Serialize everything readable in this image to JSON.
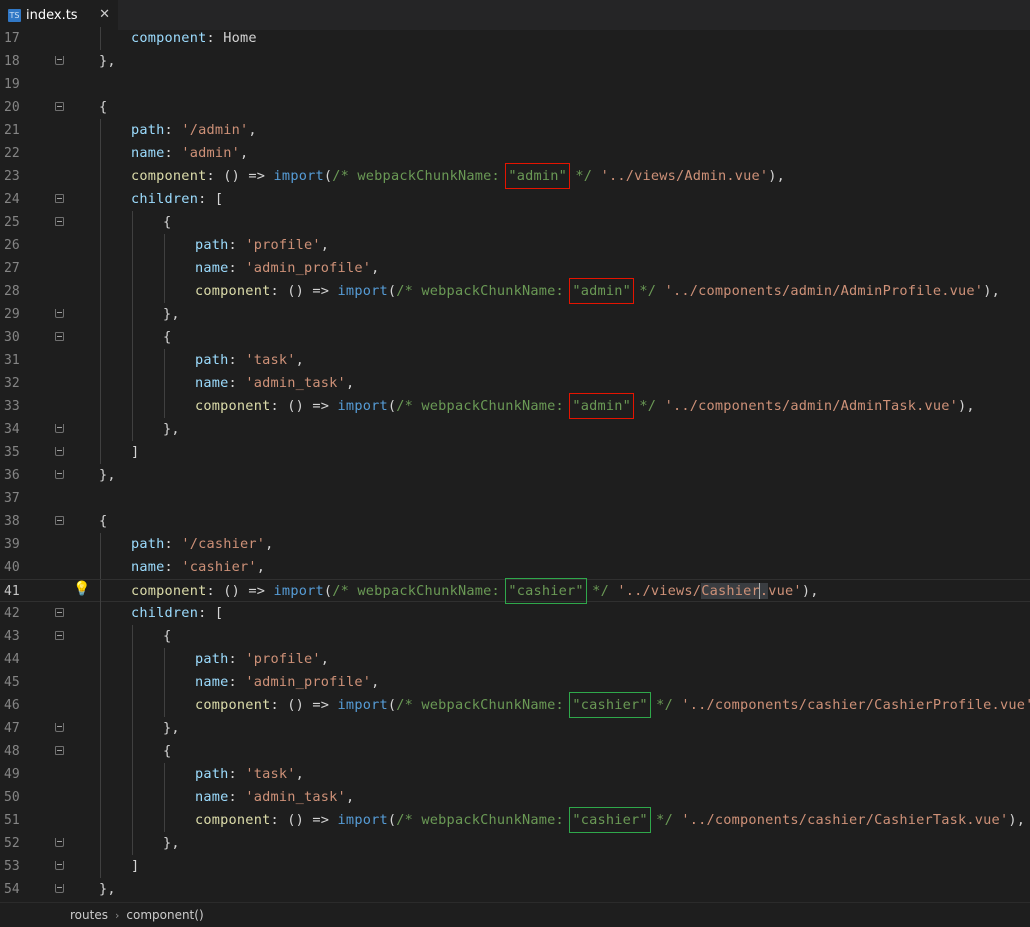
{
  "tab": {
    "label": "index.ts",
    "icon_text": "TS",
    "close_glyph": "✕"
  },
  "breadcrumb": {
    "items": [
      "routes",
      "component()"
    ],
    "separator": "›"
  },
  "colors": {
    "background": "#1e1e1e",
    "red_box": "#e51400",
    "green_box": "#2fa84b"
  },
  "editor": {
    "current_line": 41,
    "lines": [
      {
        "n": "17",
        "indent": 2,
        "fold": "",
        "tokens": [
          [
            "k",
            "component"
          ],
          [
            "p",
            ": Home"
          ]
        ]
      },
      {
        "n": "18",
        "indent": 1,
        "fold": "end",
        "tokens": [
          [
            "p",
            "},"
          ]
        ]
      },
      {
        "n": "19",
        "indent": 0,
        "fold": "",
        "tokens": []
      },
      {
        "n": "20",
        "indent": 1,
        "fold": "start",
        "tokens": [
          [
            "p",
            "{"
          ]
        ]
      },
      {
        "n": "21",
        "indent": 2,
        "fold": "",
        "tokens": [
          [
            "k",
            "path"
          ],
          [
            "p",
            ": "
          ],
          [
            "s",
            "'/admin'"
          ],
          [
            "p",
            ","
          ]
        ]
      },
      {
        "n": "22",
        "indent": 2,
        "fold": "",
        "tokens": [
          [
            "k",
            "name"
          ],
          [
            "p",
            ": "
          ],
          [
            "s",
            "'admin'"
          ],
          [
            "p",
            ","
          ]
        ]
      },
      {
        "n": "23",
        "indent": 2,
        "fold": "",
        "tokens": [
          [
            "fn",
            "component"
          ],
          [
            "p",
            ": () => "
          ],
          [
            "kw",
            "import"
          ],
          [
            "p",
            "("
          ],
          [
            "c",
            "/* webpackChunkName: "
          ],
          [
            "c-red",
            "\"admin\""
          ],
          [
            "c",
            " */"
          ],
          [
            "p",
            " "
          ],
          [
            "s",
            "'../views/Admin.vue'"
          ],
          [
            "p",
            "),"
          ]
        ]
      },
      {
        "n": "24",
        "indent": 2,
        "fold": "start",
        "tokens": [
          [
            "k",
            "children"
          ],
          [
            "p",
            ": ["
          ]
        ]
      },
      {
        "n": "25",
        "indent": 3,
        "fold": "start",
        "tokens": [
          [
            "p",
            "{"
          ]
        ]
      },
      {
        "n": "26",
        "indent": 4,
        "fold": "",
        "tokens": [
          [
            "k",
            "path"
          ],
          [
            "p",
            ": "
          ],
          [
            "s",
            "'profile'"
          ],
          [
            "p",
            ","
          ]
        ]
      },
      {
        "n": "27",
        "indent": 4,
        "fold": "",
        "tokens": [
          [
            "k",
            "name"
          ],
          [
            "p",
            ": "
          ],
          [
            "s",
            "'admin_profile'"
          ],
          [
            "p",
            ","
          ]
        ]
      },
      {
        "n": "28",
        "indent": 4,
        "fold": "",
        "tokens": [
          [
            "fn",
            "component"
          ],
          [
            "p",
            ": () => "
          ],
          [
            "kw",
            "import"
          ],
          [
            "p",
            "("
          ],
          [
            "c",
            "/* webpackChunkName: "
          ],
          [
            "c-red",
            "\"admin\""
          ],
          [
            "c",
            " */"
          ],
          [
            "p",
            " "
          ],
          [
            "s",
            "'../components/admin/AdminProfile.vue'"
          ],
          [
            "p",
            "),"
          ]
        ]
      },
      {
        "n": "29",
        "indent": 3,
        "fold": "end",
        "tokens": [
          [
            "p",
            "},"
          ]
        ]
      },
      {
        "n": "30",
        "indent": 3,
        "fold": "start",
        "tokens": [
          [
            "p",
            "{"
          ]
        ]
      },
      {
        "n": "31",
        "indent": 4,
        "fold": "",
        "tokens": [
          [
            "k",
            "path"
          ],
          [
            "p",
            ": "
          ],
          [
            "s",
            "'task'"
          ],
          [
            "p",
            ","
          ]
        ]
      },
      {
        "n": "32",
        "indent": 4,
        "fold": "",
        "tokens": [
          [
            "k",
            "name"
          ],
          [
            "p",
            ": "
          ],
          [
            "s",
            "'admin_task'"
          ],
          [
            "p",
            ","
          ]
        ]
      },
      {
        "n": "33",
        "indent": 4,
        "fold": "",
        "tokens": [
          [
            "fn",
            "component"
          ],
          [
            "p",
            ": () => "
          ],
          [
            "kw",
            "import"
          ],
          [
            "p",
            "("
          ],
          [
            "c",
            "/* webpackChunkName: "
          ],
          [
            "c-red",
            "\"admin\""
          ],
          [
            "c",
            " */"
          ],
          [
            "p",
            " "
          ],
          [
            "s",
            "'../components/admin/AdminTask.vue'"
          ],
          [
            "p",
            "),"
          ]
        ]
      },
      {
        "n": "34",
        "indent": 3,
        "fold": "end",
        "tokens": [
          [
            "p",
            "},"
          ]
        ]
      },
      {
        "n": "35",
        "indent": 2,
        "fold": "end",
        "tokens": [
          [
            "p",
            "]"
          ]
        ]
      },
      {
        "n": "36",
        "indent": 1,
        "fold": "end",
        "tokens": [
          [
            "p",
            "},"
          ]
        ]
      },
      {
        "n": "37",
        "indent": 0,
        "fold": "",
        "tokens": []
      },
      {
        "n": "38",
        "indent": 1,
        "fold": "start",
        "tokens": [
          [
            "p",
            "{"
          ]
        ]
      },
      {
        "n": "39",
        "indent": 2,
        "fold": "",
        "tokens": [
          [
            "k",
            "path"
          ],
          [
            "p",
            ": "
          ],
          [
            "s",
            "'/cashier'"
          ],
          [
            "p",
            ","
          ]
        ]
      },
      {
        "n": "40",
        "indent": 2,
        "fold": "",
        "tokens": [
          [
            "k",
            "name"
          ],
          [
            "p",
            ": "
          ],
          [
            "s",
            "'cashier'"
          ],
          [
            "p",
            ","
          ]
        ]
      },
      {
        "n": "41",
        "indent": 2,
        "fold": "",
        "bulb": true,
        "tokens": [
          [
            "fn",
            "component"
          ],
          [
            "p",
            ": () => "
          ],
          [
            "kw",
            "import"
          ],
          [
            "p",
            "("
          ],
          [
            "c",
            "/* webpackChunkName: "
          ],
          [
            "c-green",
            "\"cashier\""
          ],
          [
            "c",
            " */"
          ],
          [
            "p",
            " "
          ],
          [
            "s",
            "'../views/"
          ],
          [
            "s-sel",
            "Cashier"
          ],
          [
            "cursor",
            ""
          ],
          [
            "s-sel",
            "."
          ],
          [
            "s",
            "vue'"
          ],
          [
            "p",
            "),"
          ]
        ]
      },
      {
        "n": "42",
        "indent": 2,
        "fold": "start",
        "tokens": [
          [
            "k",
            "children"
          ],
          [
            "p",
            ": ["
          ]
        ]
      },
      {
        "n": "43",
        "indent": 3,
        "fold": "start",
        "tokens": [
          [
            "p",
            "{"
          ]
        ]
      },
      {
        "n": "44",
        "indent": 4,
        "fold": "",
        "tokens": [
          [
            "k",
            "path"
          ],
          [
            "p",
            ": "
          ],
          [
            "s",
            "'profile'"
          ],
          [
            "p",
            ","
          ]
        ]
      },
      {
        "n": "45",
        "indent": 4,
        "fold": "",
        "tokens": [
          [
            "k",
            "name"
          ],
          [
            "p",
            ": "
          ],
          [
            "s",
            "'admin_profile'"
          ],
          [
            "p",
            ","
          ]
        ]
      },
      {
        "n": "46",
        "indent": 4,
        "fold": "",
        "tokens": [
          [
            "fn",
            "component"
          ],
          [
            "p",
            ": () => "
          ],
          [
            "kw",
            "import"
          ],
          [
            "p",
            "("
          ],
          [
            "c",
            "/* webpackChunkName: "
          ],
          [
            "c-green",
            "\"cashier\""
          ],
          [
            "c",
            " */"
          ],
          [
            "p",
            " "
          ],
          [
            "s",
            "'../components/cashier/CashierProfile.vue'"
          ],
          [
            "p",
            "),"
          ]
        ]
      },
      {
        "n": "47",
        "indent": 3,
        "fold": "end",
        "tokens": [
          [
            "p",
            "},"
          ]
        ]
      },
      {
        "n": "48",
        "indent": 3,
        "fold": "start",
        "tokens": [
          [
            "p",
            "{"
          ]
        ]
      },
      {
        "n": "49",
        "indent": 4,
        "fold": "",
        "tokens": [
          [
            "k",
            "path"
          ],
          [
            "p",
            ": "
          ],
          [
            "s",
            "'task'"
          ],
          [
            "p",
            ","
          ]
        ]
      },
      {
        "n": "50",
        "indent": 4,
        "fold": "",
        "tokens": [
          [
            "k",
            "name"
          ],
          [
            "p",
            ": "
          ],
          [
            "s",
            "'admin_task'"
          ],
          [
            "p",
            ","
          ]
        ]
      },
      {
        "n": "51",
        "indent": 4,
        "fold": "",
        "tokens": [
          [
            "fn",
            "component"
          ],
          [
            "p",
            ": () => "
          ],
          [
            "kw",
            "import"
          ],
          [
            "p",
            "("
          ],
          [
            "c",
            "/* webpackChunkName: "
          ],
          [
            "c-green",
            "\"cashier\""
          ],
          [
            "c",
            " */"
          ],
          [
            "p",
            " "
          ],
          [
            "s",
            "'../components/cashier/CashierTask.vue'"
          ],
          [
            "p",
            "),"
          ]
        ]
      },
      {
        "n": "52",
        "indent": 3,
        "fold": "end",
        "tokens": [
          [
            "p",
            "},"
          ]
        ]
      },
      {
        "n": "53",
        "indent": 2,
        "fold": "end",
        "tokens": [
          [
            "p",
            "]"
          ]
        ]
      },
      {
        "n": "54",
        "indent": 1,
        "fold": "end",
        "tokens": [
          [
            "p",
            "},"
          ]
        ]
      }
    ]
  }
}
